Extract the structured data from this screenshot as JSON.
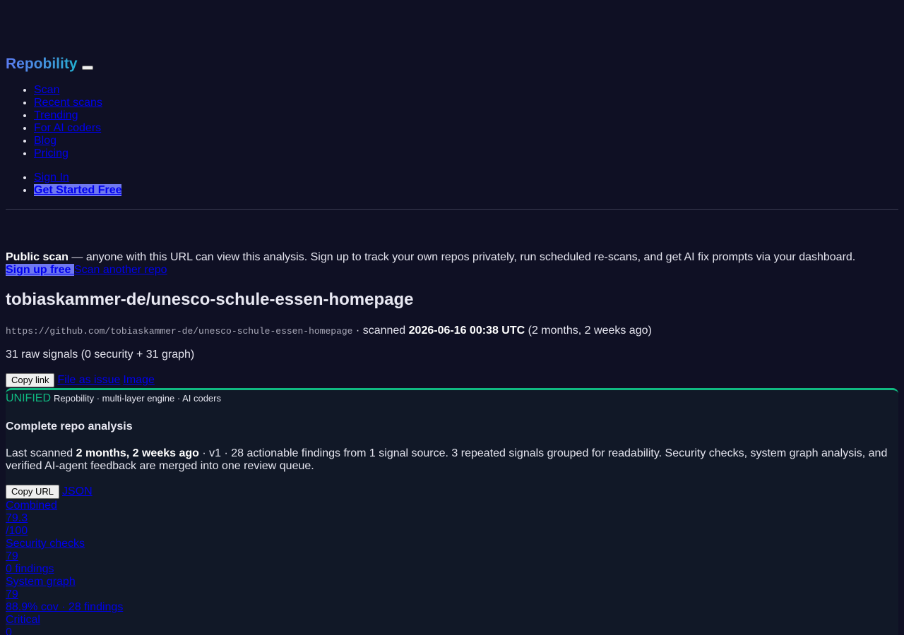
{
  "brand": {
    "name": "Repobility"
  },
  "nav": {
    "main": [
      "Scan",
      "Recent scans",
      "Trending",
      "For AI coders",
      "Blog",
      "Pricing"
    ],
    "auth": {
      "sign_in": "Sign In",
      "get_started": "Get Started Free"
    }
  },
  "notice": {
    "bold": "Public scan",
    "text": " — anyone with this URL can view this analysis. Sign up to track your own repos privately, run scheduled re-scans, and get AI fix prompts via your dashboard.",
    "signup": "Sign up free ",
    "scan_another": "Scan another repo"
  },
  "repo": {
    "title": "tobiaskammer-de/unesco-schule-essen-homepage",
    "url": "https://github.com/tobiaskammer-de/unesco-schule-essen-homepage",
    "scanned_prefix": " · scanned ",
    "scanned_at": "2026-06-16 00:38 UTC",
    "scanned_ago": " (2 months, 2 weeks ago)",
    "signals": "31 raw signals (0 security + 31 graph)"
  },
  "actions": {
    "copy_link": "Copy link",
    "file_issue": "File as issue",
    "image": "Image"
  },
  "unified": {
    "badge": "UNIFIED",
    "badge_sub": "Repobility · multi-layer engine · AI coders",
    "title": "Complete repo analysis",
    "desc_prefix": "Last scanned ",
    "desc_when": "2 months, 2 weeks ago",
    "desc_rest": " · v1 · 28 actionable findings from 1 signal source. 3 repeated signals grouped for readability. Security checks, system graph analysis, and verified AI-agent feedback are merged into one review queue.",
    "copy_url": "Copy URL",
    "json": "JSON"
  },
  "stats": [
    {
      "label": "Combined",
      "value": "79.3",
      "sub": "/100"
    },
    {
      "label": "Security checks",
      "value": "79",
      "sub": "0 findings"
    },
    {
      "label": "System graph",
      "value": "79",
      "sub": "88.9% cov · 28 findings"
    },
    {
      "label": "Critical",
      "value": "0"
    }
  ]
}
